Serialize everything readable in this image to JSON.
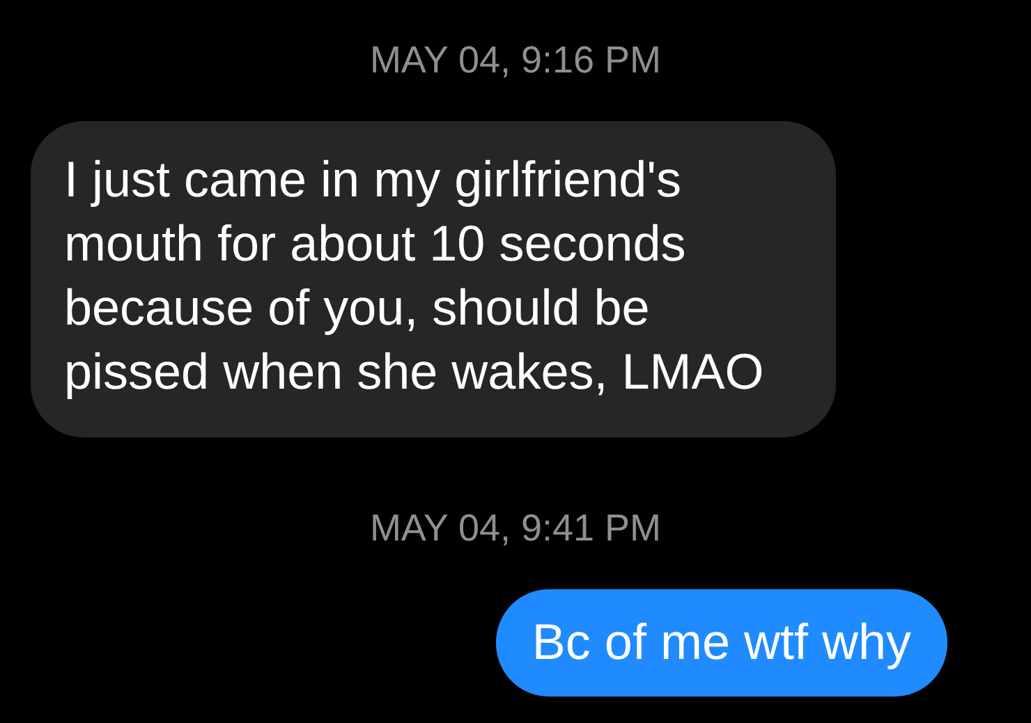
{
  "conversation": [
    {
      "kind": "timestamp",
      "text": "MAY 04, 9:16 PM"
    },
    {
      "kind": "incoming_message",
      "text": "I just came in my girlfriend's mouth for about 10 seconds because of you, should be pissed when she wakes, LMAO"
    },
    {
      "kind": "timestamp",
      "text": "MAY 04, 9:41 PM"
    },
    {
      "kind": "outgoing_message",
      "text": "Bc of me wtf why"
    }
  ]
}
